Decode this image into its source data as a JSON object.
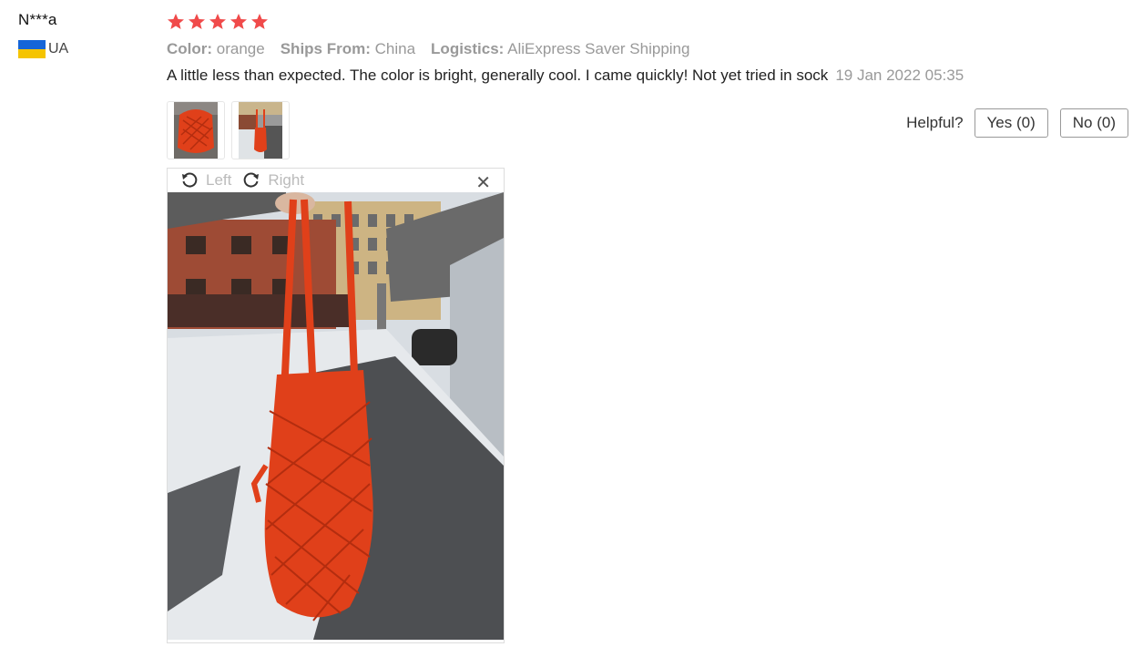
{
  "user": {
    "name": "N***a",
    "country": "UA"
  },
  "rating": {
    "stars": 5,
    "star_color": "#f04a4a"
  },
  "attributes": [
    {
      "key": "Color:",
      "value": "orange"
    },
    {
      "key": "Ships From:",
      "value": "China"
    },
    {
      "key": "Logistics:",
      "value": "AliExpress Saver Shipping"
    }
  ],
  "review": {
    "text": "A little less than expected. The color is bright, generally cool. I came quickly! Not yet tried in sock",
    "date": "19 Jan 2022 05:35"
  },
  "helpful": {
    "label": "Helpful?",
    "yes": "Yes (0)",
    "no": "No (0)"
  },
  "viewer": {
    "left_label": "Left",
    "right_label": "Right",
    "close_icon": "close-icon"
  },
  "colors": {
    "bag": "#e0401a",
    "muted": "#999999"
  }
}
